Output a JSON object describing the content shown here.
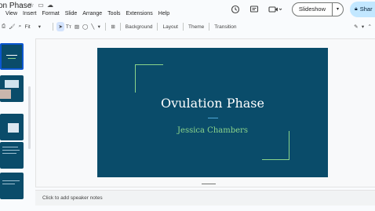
{
  "app": {
    "doc_title": "on Phase",
    "menu": [
      "t",
      "View",
      "Insert",
      "Format",
      "Slide",
      "Arrange",
      "Tools",
      "Extensions",
      "Help"
    ],
    "slideshow_label": "Slideshow",
    "share_label": "Shar"
  },
  "toolbar": {
    "zoom_label": "Fit",
    "background_label": "Background",
    "layout_label": "Layout",
    "theme_label": "Theme",
    "transition_label": "Transition"
  },
  "slide": {
    "title": "Ovulation Phase",
    "subtitle": "Jessica Chambers",
    "background_color": "#0a4c6a",
    "accent_color": "#8bd48b"
  },
  "notes": {
    "placeholder": "Click to add speaker notes"
  },
  "icons": {
    "history": "history-icon",
    "comment": "comment-icon",
    "video": "video-icon",
    "star": "star-icon",
    "folder": "folder-icon",
    "cloud": "cloud-icon"
  }
}
